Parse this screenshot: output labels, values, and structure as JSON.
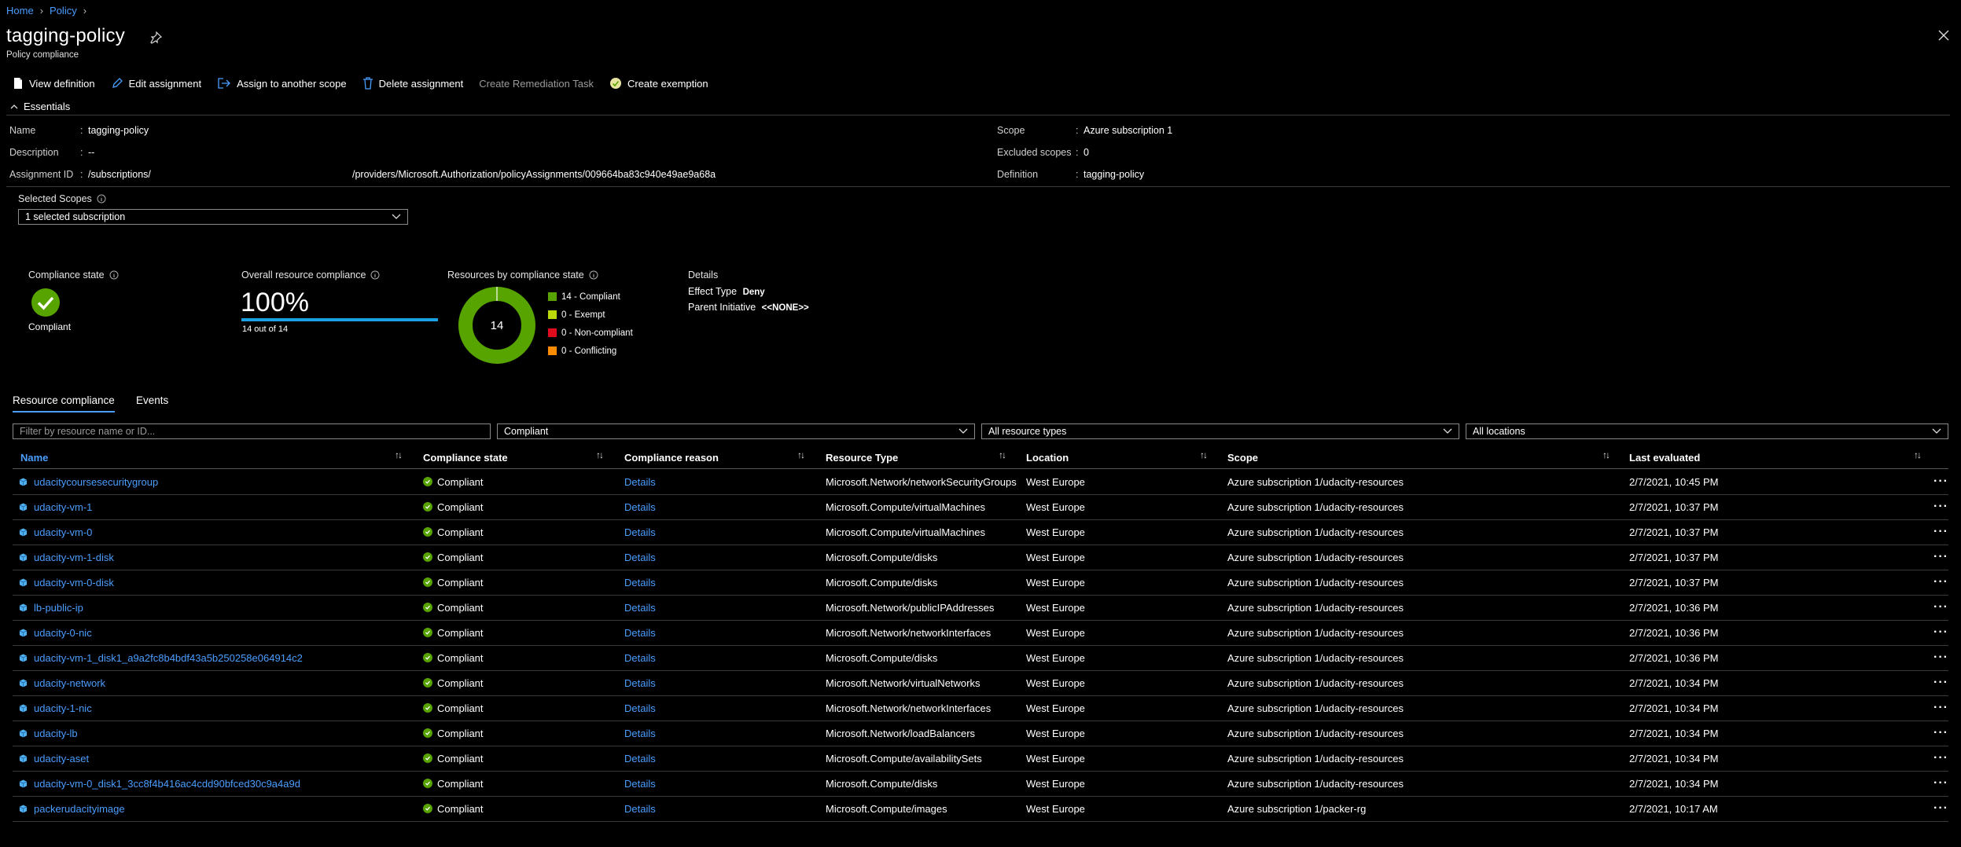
{
  "breadcrumb": {
    "home": "Home",
    "policy": "Policy"
  },
  "header": {
    "title": "tagging-policy",
    "subtitle": "Policy compliance"
  },
  "toolbar": {
    "view_definition": "View definition",
    "edit_assignment": "Edit assignment",
    "assign_scope": "Assign to another scope",
    "delete_assignment": "Delete assignment",
    "create_remediation": "Create Remediation Task",
    "create_exemption": "Create exemption"
  },
  "essentials": {
    "title": "Essentials",
    "name_label": "Name",
    "name_value": "tagging-policy",
    "description_label": "Description",
    "description_value": "--",
    "assignment_id_label": "Assignment ID",
    "assignment_id_prefix": "/subscriptions/",
    "assignment_id_suffix": "/providers/Microsoft.Authorization/policyAssignments/009664ba83c940e49ae9a68a",
    "scope_label": "Scope",
    "scope_value": "Azure subscription 1",
    "excluded_label": "Excluded scopes",
    "excluded_value": "0",
    "definition_label": "Definition",
    "definition_value": "tagging-policy"
  },
  "scopes": {
    "label": "Selected Scopes",
    "value": "1 selected subscription"
  },
  "summary": {
    "compliance_state_label": "Compliance state",
    "compliance_state_value": "Compliant",
    "overall_label": "Overall resource compliance",
    "overall_value": "100%",
    "overall_progress": 1.0,
    "overall_sub": "14 out of 14",
    "by_state_label": "Resources by compliance state",
    "donut_center": "14",
    "legend": [
      {
        "label": "14 - Compliant",
        "color": "#57a300",
        "count": 14
      },
      {
        "label": "0 - Exempt",
        "color": "#bad80a",
        "count": 0
      },
      {
        "label": "0 - Non-compliant",
        "color": "#e00b1c",
        "count": 0
      },
      {
        "label": "0 - Conflicting",
        "color": "#ff8c00",
        "count": 0
      }
    ],
    "details_title": "Details",
    "effect_label": "Effect Type",
    "effect_value": "Deny",
    "parent_label": "Parent Initiative",
    "parent_value": "<<NONE>>"
  },
  "tabs": {
    "resource_compliance": "Resource compliance",
    "events": "Events"
  },
  "filters": {
    "search_placeholder": "Filter by resource name or ID...",
    "compliance": "Compliant",
    "resource_types": "All resource types",
    "locations": "All locations"
  },
  "table": {
    "headers": {
      "name": "Name",
      "state": "Compliance state",
      "reason": "Compliance reason",
      "type": "Resource Type",
      "location": "Location",
      "scope": "Scope",
      "evaluated": "Last evaluated"
    },
    "rows": [
      {
        "name": "udacitycoursesecuritygroup",
        "state": "Compliant",
        "reason": "Details",
        "type": "Microsoft.Network/networkSecurityGroups",
        "location": "West Europe",
        "scope": "Azure subscription 1/udacity-resources",
        "evaluated": "2/7/2021, 10:45 PM"
      },
      {
        "name": "udacity-vm-1",
        "state": "Compliant",
        "reason": "Details",
        "type": "Microsoft.Compute/virtualMachines",
        "location": "West Europe",
        "scope": "Azure subscription 1/udacity-resources",
        "evaluated": "2/7/2021, 10:37 PM"
      },
      {
        "name": "udacity-vm-0",
        "state": "Compliant",
        "reason": "Details",
        "type": "Microsoft.Compute/virtualMachines",
        "location": "West Europe",
        "scope": "Azure subscription 1/udacity-resources",
        "evaluated": "2/7/2021, 10:37 PM"
      },
      {
        "name": "udacity-vm-1-disk",
        "state": "Compliant",
        "reason": "Details",
        "type": "Microsoft.Compute/disks",
        "location": "West Europe",
        "scope": "Azure subscription 1/udacity-resources",
        "evaluated": "2/7/2021, 10:37 PM"
      },
      {
        "name": "udacity-vm-0-disk",
        "state": "Compliant",
        "reason": "Details",
        "type": "Microsoft.Compute/disks",
        "location": "West Europe",
        "scope": "Azure subscription 1/udacity-resources",
        "evaluated": "2/7/2021, 10:37 PM"
      },
      {
        "name": "lb-public-ip",
        "state": "Compliant",
        "reason": "Details",
        "type": "Microsoft.Network/publicIPAddresses",
        "location": "West Europe",
        "scope": "Azure subscription 1/udacity-resources",
        "evaluated": "2/7/2021, 10:36 PM"
      },
      {
        "name": "udacity-0-nic",
        "state": "Compliant",
        "reason": "Details",
        "type": "Microsoft.Network/networkInterfaces",
        "location": "West Europe",
        "scope": "Azure subscription 1/udacity-resources",
        "evaluated": "2/7/2021, 10:36 PM"
      },
      {
        "name": "udacity-vm-1_disk1_a9a2fc8b4bdf43a5b250258e064914c2",
        "state": "Compliant",
        "reason": "Details",
        "type": "Microsoft.Compute/disks",
        "location": "West Europe",
        "scope": "Azure subscription 1/udacity-resources",
        "evaluated": "2/7/2021, 10:36 PM"
      },
      {
        "name": "udacity-network",
        "state": "Compliant",
        "reason": "Details",
        "type": "Microsoft.Network/virtualNetworks",
        "location": "West Europe",
        "scope": "Azure subscription 1/udacity-resources",
        "evaluated": "2/7/2021, 10:34 PM"
      },
      {
        "name": "udacity-1-nic",
        "state": "Compliant",
        "reason": "Details",
        "type": "Microsoft.Network/networkInterfaces",
        "location": "West Europe",
        "scope": "Azure subscription 1/udacity-resources",
        "evaluated": "2/7/2021, 10:34 PM"
      },
      {
        "name": "udacity-lb",
        "state": "Compliant",
        "reason": "Details",
        "type": "Microsoft.Network/loadBalancers",
        "location": "West Europe",
        "scope": "Azure subscription 1/udacity-resources",
        "evaluated": "2/7/2021, 10:34 PM"
      },
      {
        "name": "udacity-aset",
        "state": "Compliant",
        "reason": "Details",
        "type": "Microsoft.Compute/availabilitySets",
        "location": "West Europe",
        "scope": "Azure subscription 1/udacity-resources",
        "evaluated": "2/7/2021, 10:34 PM"
      },
      {
        "name": "udacity-vm-0_disk1_3cc8f4b416ac4cdd90bfced30c9a4a9d",
        "state": "Compliant",
        "reason": "Details",
        "type": "Microsoft.Compute/disks",
        "location": "West Europe",
        "scope": "Azure subscription 1/udacity-resources",
        "evaluated": "2/7/2021, 10:34 PM"
      },
      {
        "name": "packerudacityimage",
        "state": "Compliant",
        "reason": "Details",
        "type": "Microsoft.Compute/images",
        "location": "West Europe",
        "scope": "Azure subscription 1/packer-rg",
        "evaluated": "2/7/2021, 10:17 AM"
      }
    ]
  },
  "colors": {
    "link": "#4a9eff",
    "compliant": "#57a300",
    "progress": "#1ba1e2",
    "background": "#000000"
  },
  "icons": [
    "home-breadcrumb",
    "pin-icon",
    "close-icon",
    "document-icon",
    "pencil-icon",
    "assign-icon",
    "trash-icon",
    "exemption-icon",
    "chevron-up-icon",
    "info-icon",
    "chevron-down-icon",
    "check-circle-icon",
    "sort-icon",
    "resource-cube-icon",
    "more-icon"
  ]
}
